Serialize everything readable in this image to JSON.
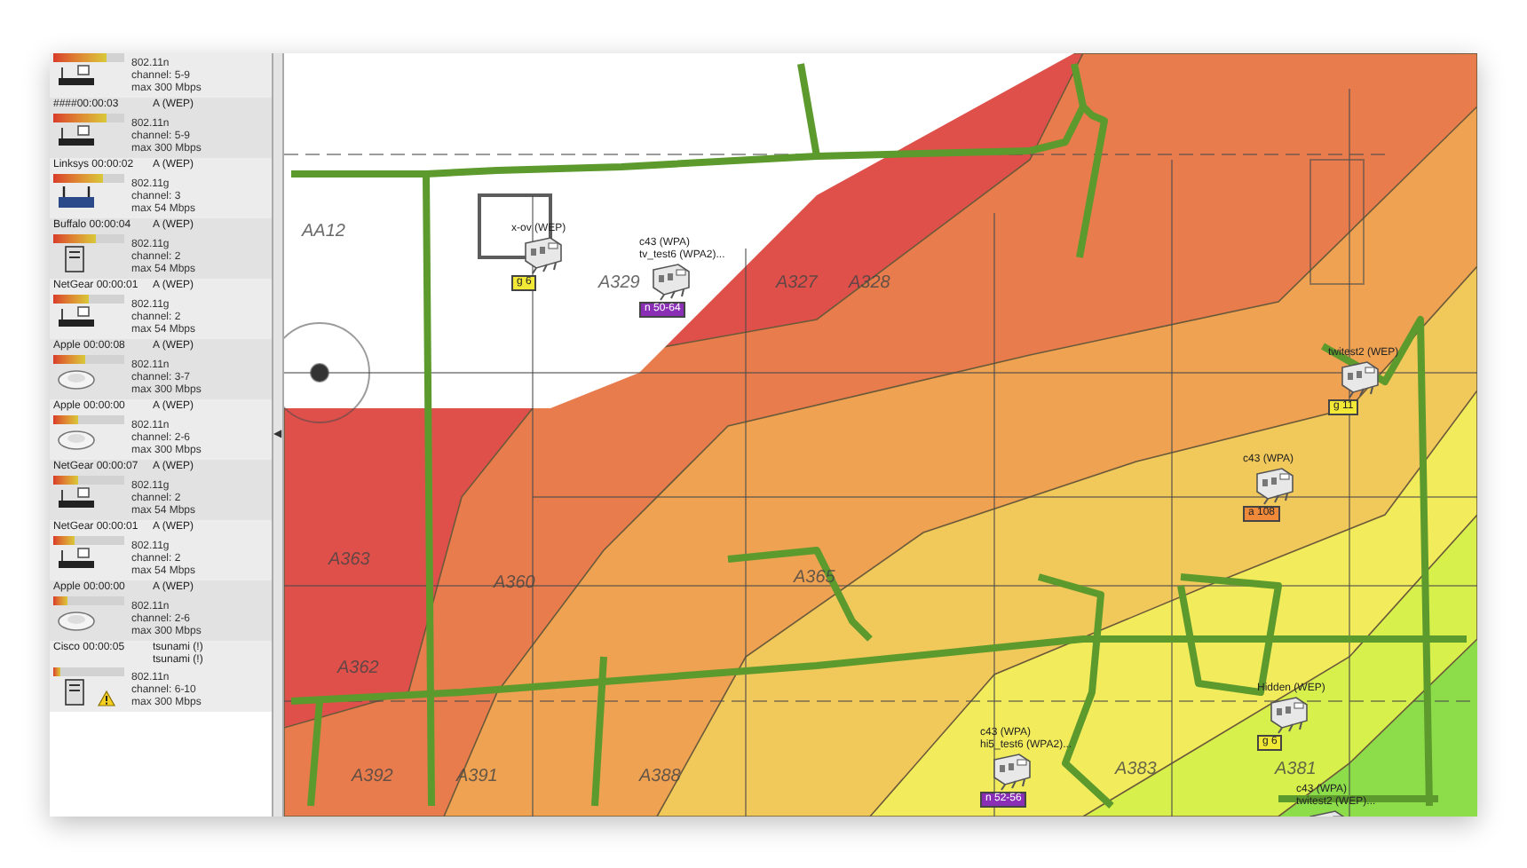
{
  "sidebar": {
    "devices": [
      {
        "kind": "router",
        "level": 0.75,
        "standard": "802.11n",
        "channel": "channel: 5-9",
        "max_rate": "max 300 Mbps",
        "warning": false
      },
      {
        "name": "####00:00:03",
        "security": [
          "A (WEP)"
        ],
        "kind": "router",
        "level": 0.75,
        "standard": "802.11n",
        "channel": "channel: 5-9",
        "max_rate": "max 300 Mbps",
        "warning": false
      },
      {
        "name": "Linksys 00:00:02",
        "security": [
          "A (WEP)"
        ],
        "kind": "antenna-router",
        "level": 0.7,
        "standard": "802.11g",
        "channel": "channel: 3",
        "max_rate": "max 54 Mbps",
        "warning": false
      },
      {
        "name": "Buffalo 00:00:04",
        "security": [
          "A (WEP)"
        ],
        "kind": "tower",
        "level": 0.6,
        "standard": "802.11g",
        "channel": "channel: 2",
        "max_rate": "max 54 Mbps",
        "warning": false
      },
      {
        "name": "NetGear 00:00:01",
        "security": [
          "A (WEP)"
        ],
        "kind": "router",
        "level": 0.5,
        "standard": "802.11g",
        "channel": "channel: 2",
        "max_rate": "max 54 Mbps",
        "warning": false
      },
      {
        "name": "Apple 00:00:08",
        "security": [
          "A (WEP)"
        ],
        "kind": "dome",
        "level": 0.45,
        "standard": "802.11n",
        "channel": "channel: 3-7",
        "max_rate": "max 300 Mbps",
        "warning": false
      },
      {
        "name": "Apple 00:00:00",
        "security": [
          "A (WEP)"
        ],
        "kind": "dome",
        "level": 0.35,
        "standard": "802.11n",
        "channel": "channel: 2-6",
        "max_rate": "max 300 Mbps",
        "warning": false
      },
      {
        "name": "NetGear 00:00:07",
        "security": [
          "A (WEP)"
        ],
        "kind": "router",
        "level": 0.35,
        "standard": "802.11g",
        "channel": "channel: 2",
        "max_rate": "max 54 Mbps",
        "warning": false
      },
      {
        "name": "NetGear 00:00:01",
        "security": [
          "A (WEP)"
        ],
        "kind": "router",
        "level": 0.3,
        "standard": "802.11g",
        "channel": "channel: 2",
        "max_rate": "max 54 Mbps",
        "warning": false
      },
      {
        "name": "Apple 00:00:00",
        "security": [
          "A (WEP)"
        ],
        "kind": "dome",
        "level": 0.2,
        "standard": "802.11n",
        "channel": "channel: 2-6",
        "max_rate": "max 300 Mbps",
        "warning": false
      },
      {
        "name": "Cisco 00:00:05",
        "security": [
          "tsunami (!)",
          "tsunami (!)"
        ],
        "kind": "tower",
        "level": 0.1,
        "standard": "802.11n",
        "channel": "channel: 6-10",
        "max_rate": "max 300 Mbps",
        "warning": true
      }
    ],
    "toggle": "◀"
  },
  "map": {
    "rooms": [
      "AA12",
      "A329",
      "A327",
      "A328",
      "A363",
      "A360",
      "A365",
      "A362",
      "A392",
      "A391",
      "A388",
      "A383",
      "A381"
    ],
    "access_points": [
      {
        "names": [
          "x-ov (WEP)"
        ],
        "badge": "g 6",
        "color": "#f2e836"
      },
      {
        "names": [
          "c43 (WPA)",
          "tv_test6 (WPA2)..."
        ],
        "badge": "n 50-64",
        "color": "#8a2fb5"
      },
      {
        "names": [
          "twitest2 (WEP)"
        ],
        "badge": "g 11",
        "color": "#f2e836"
      },
      {
        "names": [
          "c43 (WPA)"
        ],
        "badge": "a 108",
        "color": "#f08a3a"
      },
      {
        "names": [
          "Hidden (WEP)"
        ],
        "badge": "g 6",
        "color": "#f2e836"
      },
      {
        "names": [
          "c43 (WPA)",
          "hi5_test6 (WPA2)..."
        ],
        "badge": "n 52-56",
        "color": "#8a2fb5"
      },
      {
        "names": [
          "c43 (WPA)",
          "twitest2 (WEP)..."
        ]
      }
    ]
  }
}
